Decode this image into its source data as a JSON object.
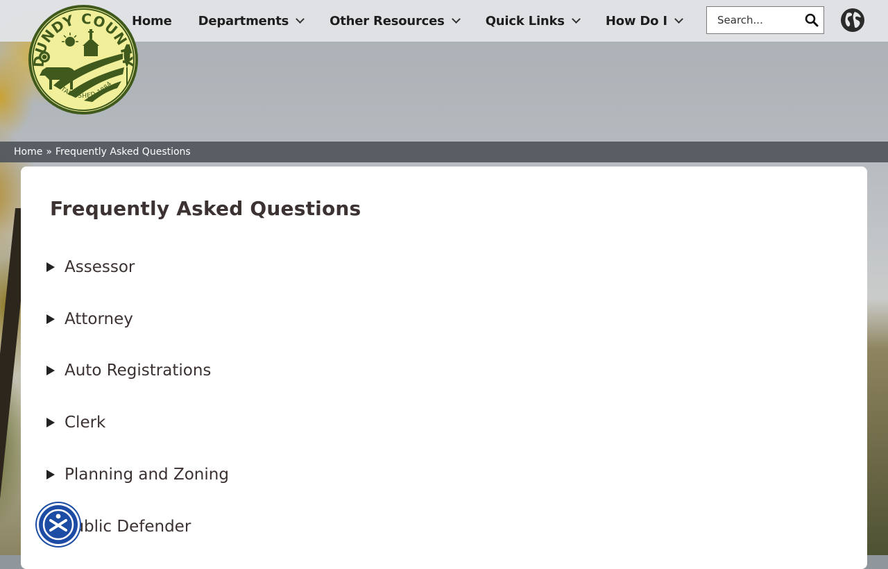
{
  "site": {
    "logo_alt": "Dundy County seal - Established 1884",
    "logo_text_top": "DUNDY COUNTY",
    "logo_text_bottom": "ESTABLISHED 1884"
  },
  "nav": {
    "items": [
      {
        "label": "Home",
        "has_dropdown": false
      },
      {
        "label": "Departments",
        "has_dropdown": true
      },
      {
        "label": "Other Resources",
        "has_dropdown": true
      },
      {
        "label": "Quick Links",
        "has_dropdown": true
      },
      {
        "label": "How Do I",
        "has_dropdown": true
      }
    ]
  },
  "search": {
    "placeholder": "Search...",
    "value": ""
  },
  "breadcrumb": {
    "home": "Home",
    "separator": "»",
    "current": "Frequently Asked Questions"
  },
  "page": {
    "title": "Frequently Asked Questions",
    "faq_sections": [
      {
        "label": "Assessor"
      },
      {
        "label": "Attorney"
      },
      {
        "label": "Auto Registrations"
      },
      {
        "label": "Clerk"
      },
      {
        "label": "Planning and Zoning"
      },
      {
        "label": "Public Defender"
      }
    ]
  },
  "colors": {
    "text_dark": "#3b3231",
    "accessibility_blue": "#1c4ca3",
    "seal_green": "#3f5a1c",
    "seal_yellow": "#f2ef9b"
  }
}
